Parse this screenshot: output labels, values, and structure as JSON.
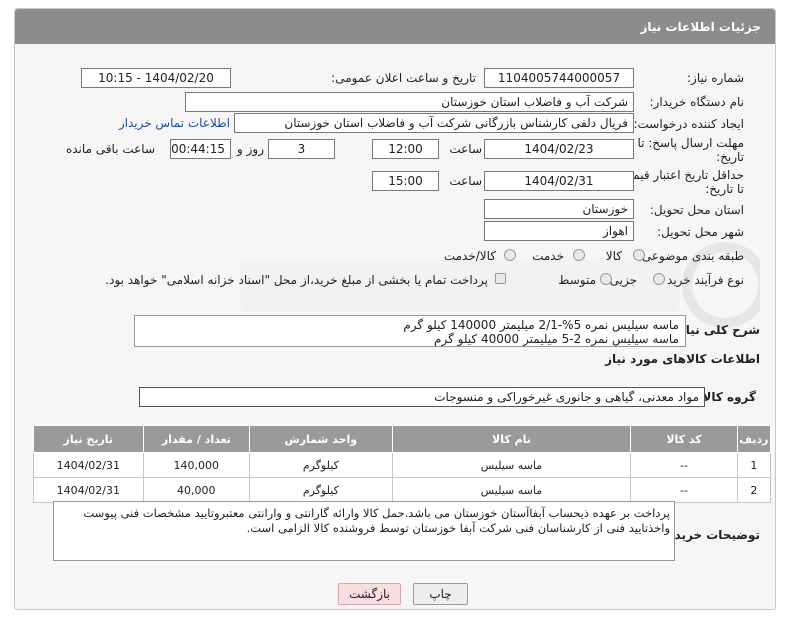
{
  "header": {
    "title": "جزئیات اطلاعات نیاز"
  },
  "form": {
    "need_number_label": "شماره نیاز:",
    "need_number": "1104005744000057",
    "announce_label": "تاریخ و ساعت اعلان عمومی:",
    "announce_value": "1404/02/20 - 10:15",
    "buyer_org_label": "نام دستگاه خریدار:",
    "buyer_org": "شرکت آب و فاضلاب استان خوزستان",
    "creator_label": "ایجاد کننده درخواست:",
    "creator": "فریال دلفی کارشناس بازرگانی شرکت آب و فاضلاب استان خوزستان",
    "buyer_contact_link": "اطلاعات تماس خریدار",
    "deadline_label_1": "مهلت ارسال پاسخ: تا",
    "deadline_label_2": "تاریخ:",
    "deadline_date": "1404/02/23",
    "time_label": "ساعت",
    "deadline_time": "12:00",
    "days_value": "3",
    "days_label": "روز و",
    "remaining_value": "00:44:15",
    "remaining_label": "ساعت باقی مانده",
    "validity_label_1": "حداقل تاریخ اعتبار قیمت:",
    "validity_label_2": "تا تاریخ:",
    "validity_date": "1404/02/31",
    "validity_time": "15:00",
    "province_label": "استان محل تحویل:",
    "province": "خوزستان",
    "city_label": "شهر محل تحویل:",
    "city": "اهواز",
    "category_label": "طبقه بندی موضوعی:",
    "category_options": [
      "کالا",
      "خدمت",
      "کالا/خدمت"
    ],
    "process_label": "نوع فرآیند خرید :",
    "process_options": [
      "جزیی",
      "متوسط"
    ],
    "payment_note": "پرداخت تمام یا بخشی از مبلغ خرید،از محل \"اسناد خزانه اسلامی\" خواهد بود."
  },
  "description": {
    "label": "شرح کلی نیاز:",
    "line1": "ماسه سیلیس نمره 5%-2/1 میلیمتر 140000 کیلو گرم",
    "line2": "ماسه سیلیس نمره 2-5 میلیمتر 40000 کیلو گرم"
  },
  "items_section": {
    "title": "اطلاعات کالاهای مورد نیاز",
    "group_label": "گروه کالا:",
    "group_value": "مواد معدنی، گیاهی و جانوری غیرخوراکی و منسوجات"
  },
  "table": {
    "headers": [
      "ردیف",
      "کد کالا",
      "نام کالا",
      "واحد شمارش",
      "تعداد / مقدار",
      "تاریخ نیاز"
    ],
    "rows": [
      [
        "1",
        "--",
        "ماسه سیلیس",
        "کیلوگرم",
        "140,000",
        "1404/02/31"
      ],
      [
        "2",
        "--",
        "ماسه سیلیس",
        "کیلوگرم",
        "40,000",
        "1404/02/31"
      ]
    ]
  },
  "buyer_notes": {
    "label": "توضیحات خریدار:",
    "line1": "پرداخت بر عهده ذیحساب آبفاآستان خوزستان می باشد.حمل کالا وارائه گارانتی و وارانتی معتبروتایید مشخصات فنی پیوست",
    "line2": "واخذتایید فنی از کارشناسان فنی شرکت آبفا خوزستان توسط فروشنده کالا الزامی است."
  },
  "buttons": {
    "print": "چاپ",
    "back": "بازگشت"
  },
  "colors": {
    "header_bg": "#8c8c8c",
    "table_header_bg": "#9a9a9a",
    "back_button_bg": "#f8dede",
    "link": "#1f4fa0"
  }
}
